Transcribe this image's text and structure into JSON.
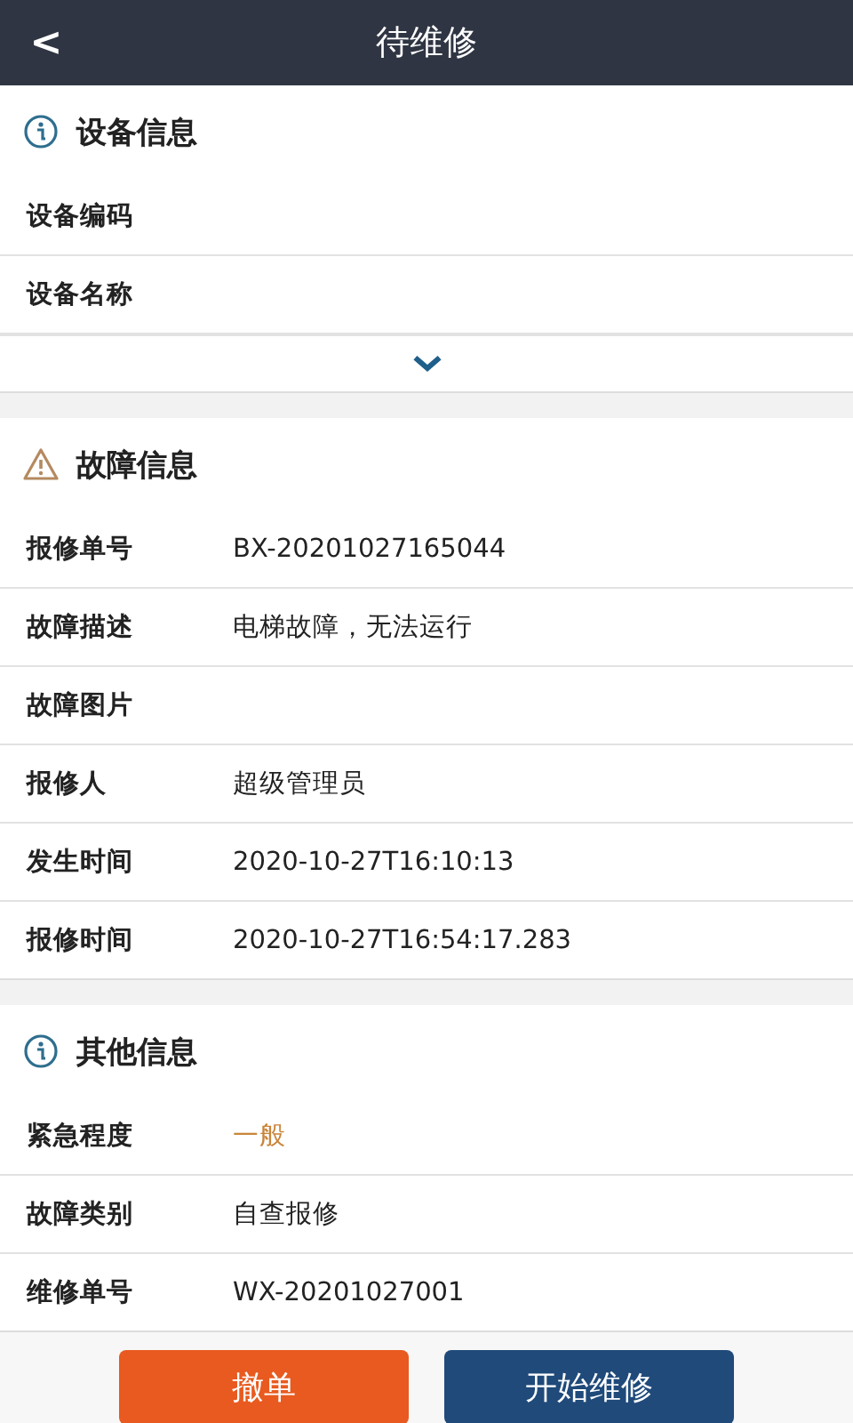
{
  "header": {
    "title": "待维修",
    "back": "<"
  },
  "sections": [
    {
      "title": "设备信息",
      "kind": "info",
      "rows": [
        {
          "label": "设备编码"
        },
        {
          "label": "设备名称"
        }
      ],
      "expandable": true
    },
    {
      "title": "故障信息",
      "kind": "warning",
      "rows": [
        {
          "label": "报修单号",
          "value": "BX-20201027165044"
        },
        {
          "label": "故障描述",
          "value": "电梯故障，无法运行"
        },
        {
          "label": "故障图片"
        },
        {
          "label": "报修人",
          "value": "超级管理员"
        },
        {
          "label": "发生时间",
          "value": "2020-10-27T16:10:13"
        },
        {
          "label": "报修时间",
          "value": "2020-10-27T16:54:17.283"
        }
      ]
    },
    {
      "title": "其他信息",
      "kind": "info",
      "rows": [
        {
          "label": "紧急程度",
          "value": "一般",
          "color": "#c8853a"
        },
        {
          "label": "故障类别",
          "value": "自查报修"
        },
        {
          "label": "维修单号",
          "value": "WX-20201027001"
        }
      ]
    }
  ],
  "buttons": [
    {
      "label": "撤单",
      "kind": "cancel"
    },
    {
      "label": "开始维修",
      "kind": "primary"
    }
  ]
}
